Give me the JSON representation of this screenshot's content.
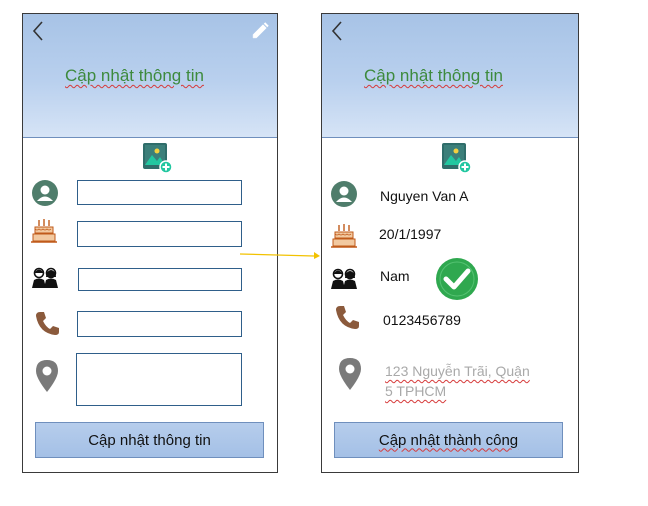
{
  "left_screen": {
    "header_title": "Cập nhật thông tin",
    "button_label": "Cập nhật thông tin",
    "fields": [
      {
        "icon": "user-icon",
        "value": ""
      },
      {
        "icon": "cake-icon",
        "value": ""
      },
      {
        "icon": "couple-icon",
        "value": ""
      },
      {
        "icon": "phone-icon",
        "value": ""
      },
      {
        "icon": "location-icon",
        "value": ""
      }
    ]
  },
  "right_screen": {
    "header_title": "Cập nhật thông tin",
    "name": "Nguyen Van A",
    "birthday": "20/1/1997",
    "gender": "Nam",
    "phone": "0123456789",
    "address_line1": "123 Nguyễn  Trãi, Quận",
    "address_line2": "5 TPHCM",
    "button_label": "Cập nhật thành công"
  },
  "colors": {
    "header_gradient_top": "#a7c3e6",
    "title_green": "#3d8a3d",
    "success_green": "#2fa84f",
    "field_border": "#2f5f8a",
    "arrow": "#f2c200"
  }
}
